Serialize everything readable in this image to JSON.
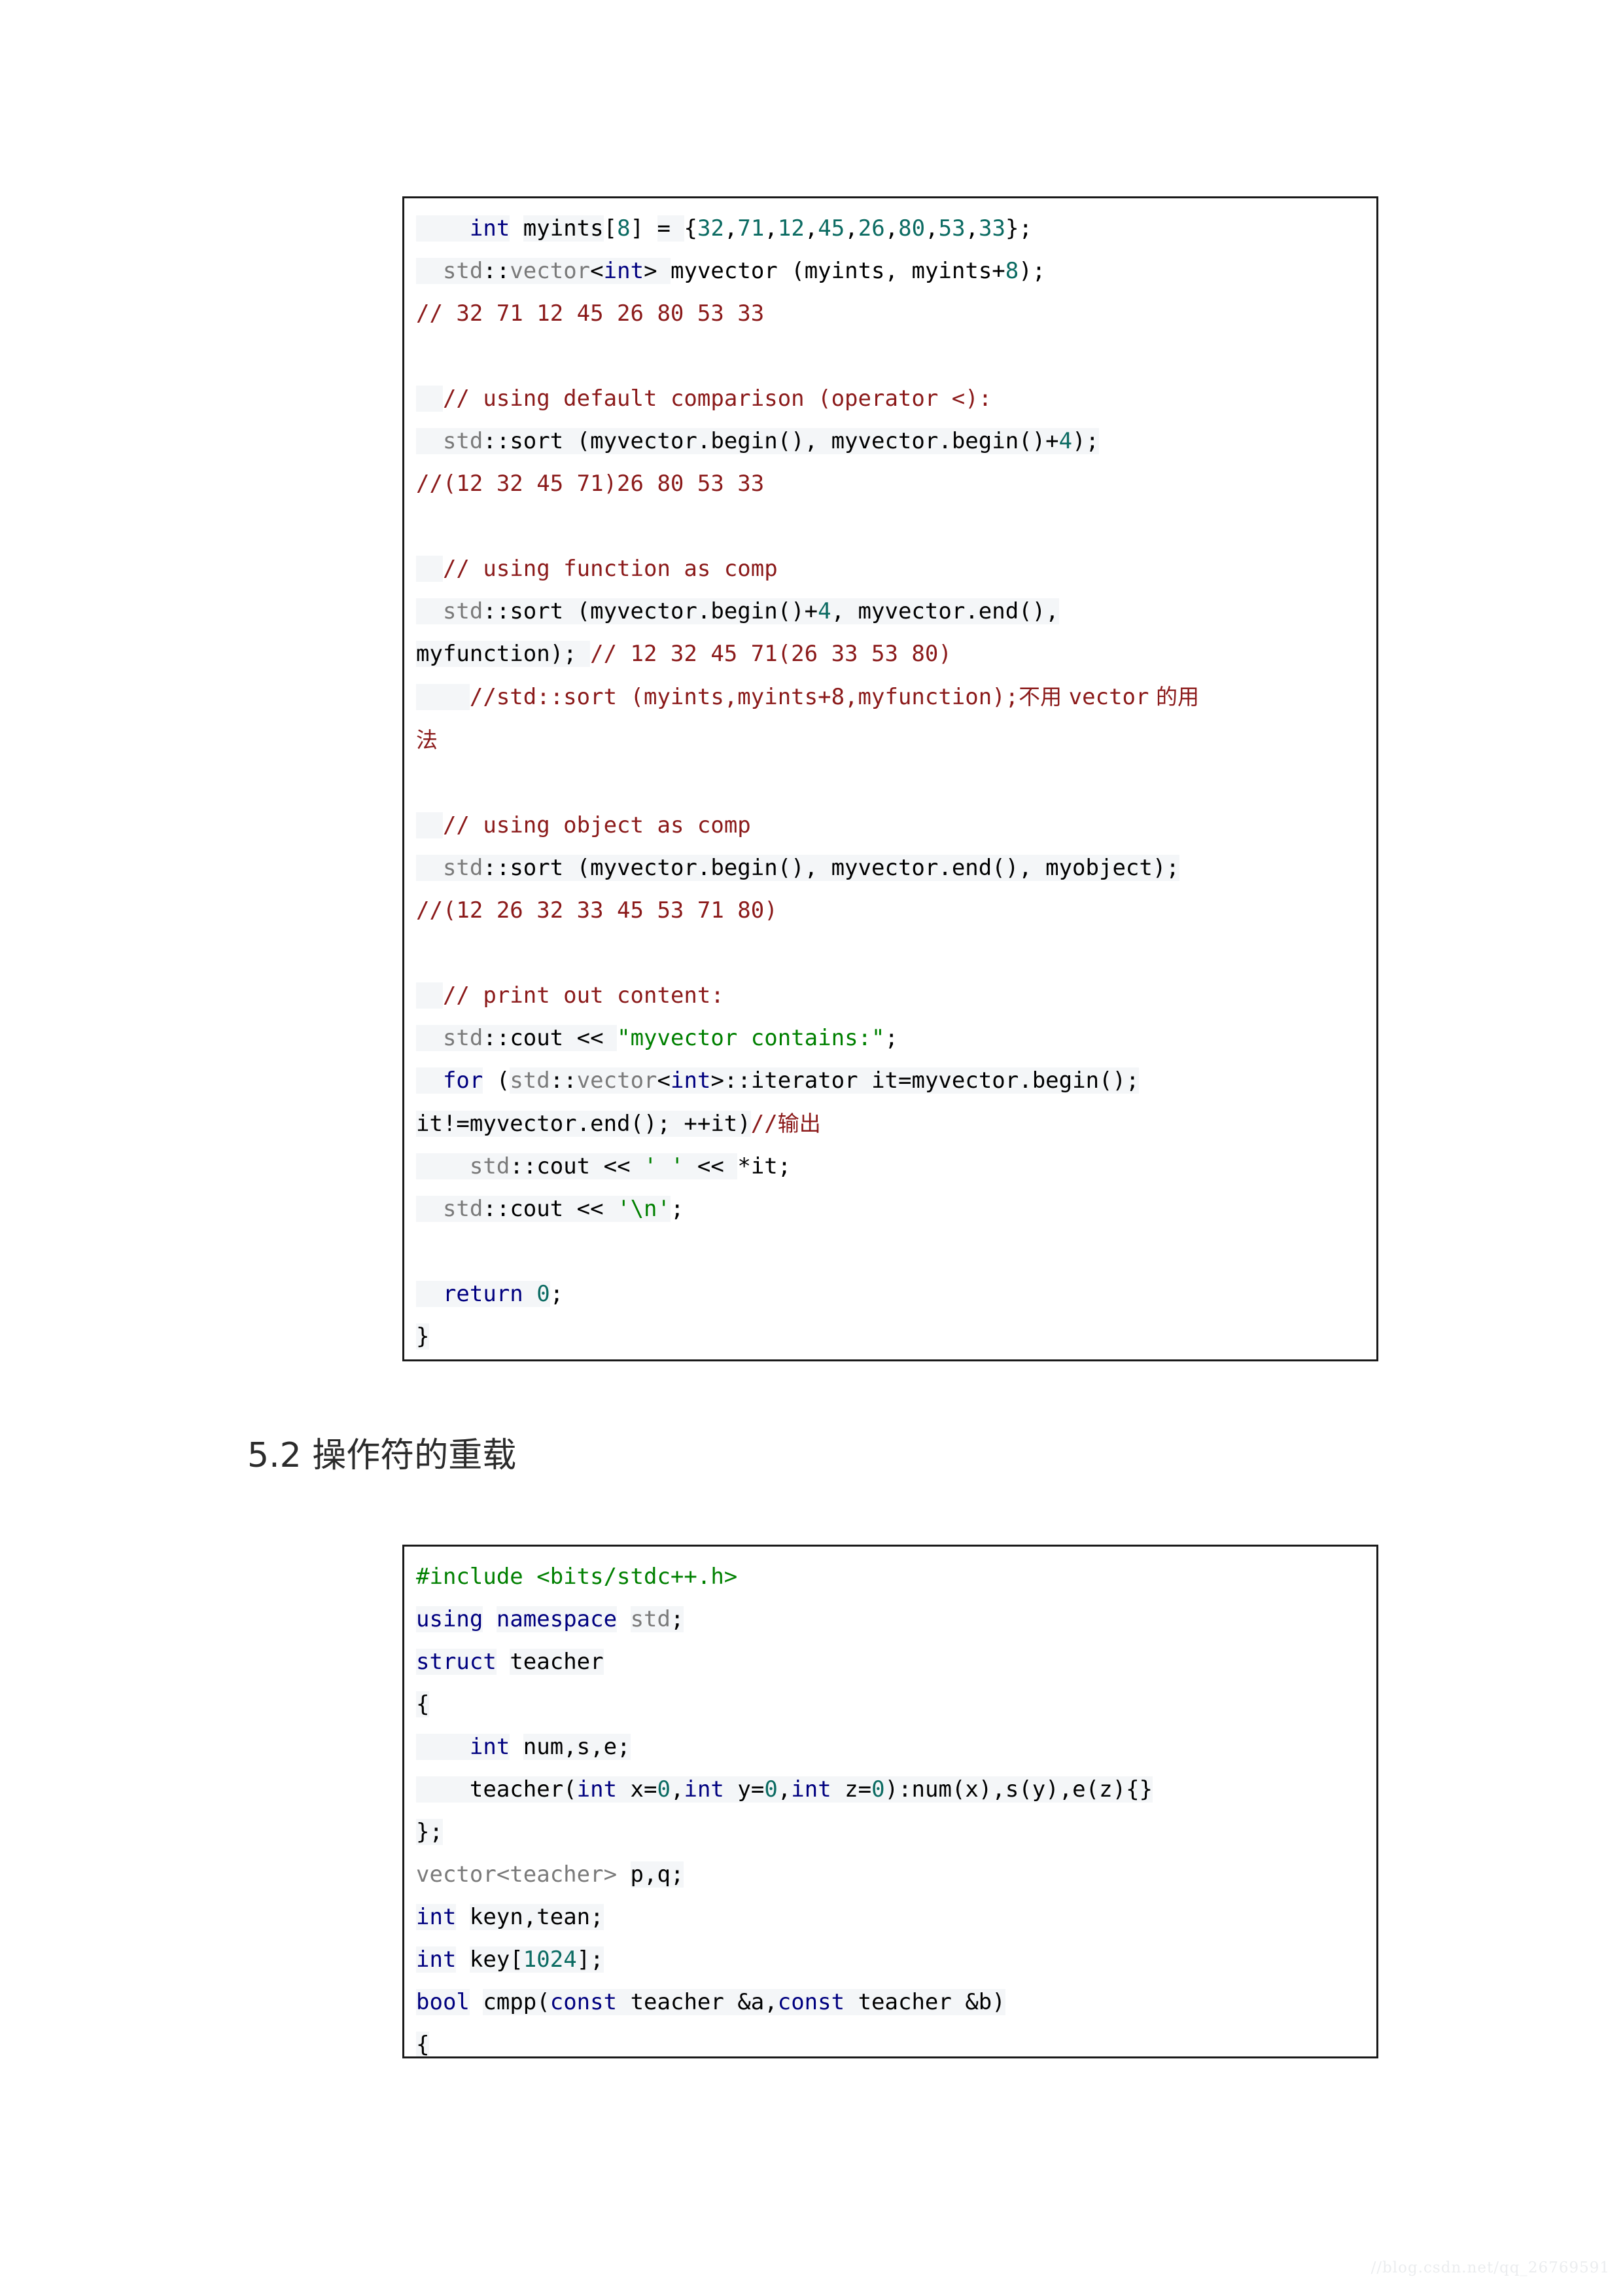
{
  "document": {
    "watermark": "//blog.csdn.net/qq_26769591"
  },
  "heading": {
    "section_number": "5.2",
    "text": "5.2 操作符的重载"
  },
  "code_block_1": {
    "language": "cpp",
    "lines": [
      "    int myints[8] = {32,71,12,45,26,80,53,33};",
      "  std::vector<int> myvector (myints, myints+8);",
      "// 32 71 12 45 26 80 53 33",
      "",
      "  // using default comparison (operator <):",
      "  std::sort (myvector.begin(), myvector.begin()+4);",
      "//(12 32 45 71)26 80 53 33",
      "",
      "  // using function as comp",
      "  std::sort (myvector.begin()+4, myvector.end(),",
      "myfunction); // 12 32 45 71(26 33 53 80)",
      "    //std::sort (myints,myints+8,myfunction);不用 vector 的用",
      "法",
      "",
      "  // using object as comp",
      "  std::sort (myvector.begin(), myvector.end(), myobject);",
      "//(12 26 32 33 45 53 71 80)",
      "",
      "  // print out content:",
      "  std::cout << \"myvector contains:\";",
      "  for (std::vector<int>::iterator it=myvector.begin();",
      "it!=myvector.end(); ++it)//输出",
      "    std::cout << ' ' << *it;",
      "  std::cout << '\\n';",
      "",
      "  return 0;",
      "}"
    ]
  },
  "code_block_2": {
    "language": "cpp",
    "lines": [
      "#include <bits/stdc++.h>",
      "using namespace std;",
      "struct teacher",
      "{",
      "    int num,s,e;",
      "    teacher(int x=0,int y=0,int z=0):num(x),s(y),e(z){}",
      "};",
      "vector<teacher> p,q;",
      "int keyn,tean;",
      "int key[1024];",
      "bool cmpp(const teacher &a,const teacher &b)",
      "{"
    ]
  },
  "colors": {
    "keyword": "#00007f",
    "number": "#0b6b62",
    "comment": "#8b1a1a",
    "string": "#008000",
    "namespace": "#7a7a7a",
    "plain": "#000000",
    "border": "#1a1a1a",
    "highlight": "#f4f6f8",
    "heading": "#2b2b2b",
    "watermark": "#ebedef"
  }
}
